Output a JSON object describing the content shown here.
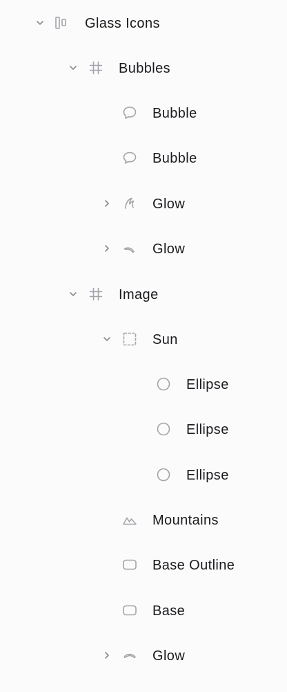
{
  "layers": [
    {
      "label": "Glass Icons",
      "icon": "frame-icon",
      "expand": "expanded"
    },
    {
      "label": "Bubbles",
      "icon": "hash-icon",
      "expand": "expanded"
    },
    {
      "label": "Bubble",
      "icon": "speech-bubble-icon",
      "expand": "none"
    },
    {
      "label": "Bubble",
      "icon": "speech-bubble-icon",
      "expand": "none"
    },
    {
      "label": "Glow",
      "icon": "glow-curve-icon",
      "expand": "collapsed"
    },
    {
      "label": "Glow",
      "icon": "glow-arc-icon",
      "expand": "collapsed"
    },
    {
      "label": "Image",
      "icon": "hash-icon",
      "expand": "expanded"
    },
    {
      "label": "Sun",
      "icon": "dashed-square-icon",
      "expand": "expanded"
    },
    {
      "label": "Ellipse",
      "icon": "ellipse-icon",
      "expand": "none"
    },
    {
      "label": "Ellipse",
      "icon": "ellipse-icon",
      "expand": "none"
    },
    {
      "label": "Ellipse",
      "icon": "ellipse-icon",
      "expand": "none"
    },
    {
      "label": "Mountains",
      "icon": "mountains-icon",
      "expand": "none"
    },
    {
      "label": "Base Outline",
      "icon": "rounded-rect-icon",
      "expand": "none"
    },
    {
      "label": "Base",
      "icon": "rounded-rect-icon",
      "expand": "none"
    },
    {
      "label": "Glow",
      "icon": "glow-arc-icon",
      "expand": "collapsed"
    }
  ]
}
